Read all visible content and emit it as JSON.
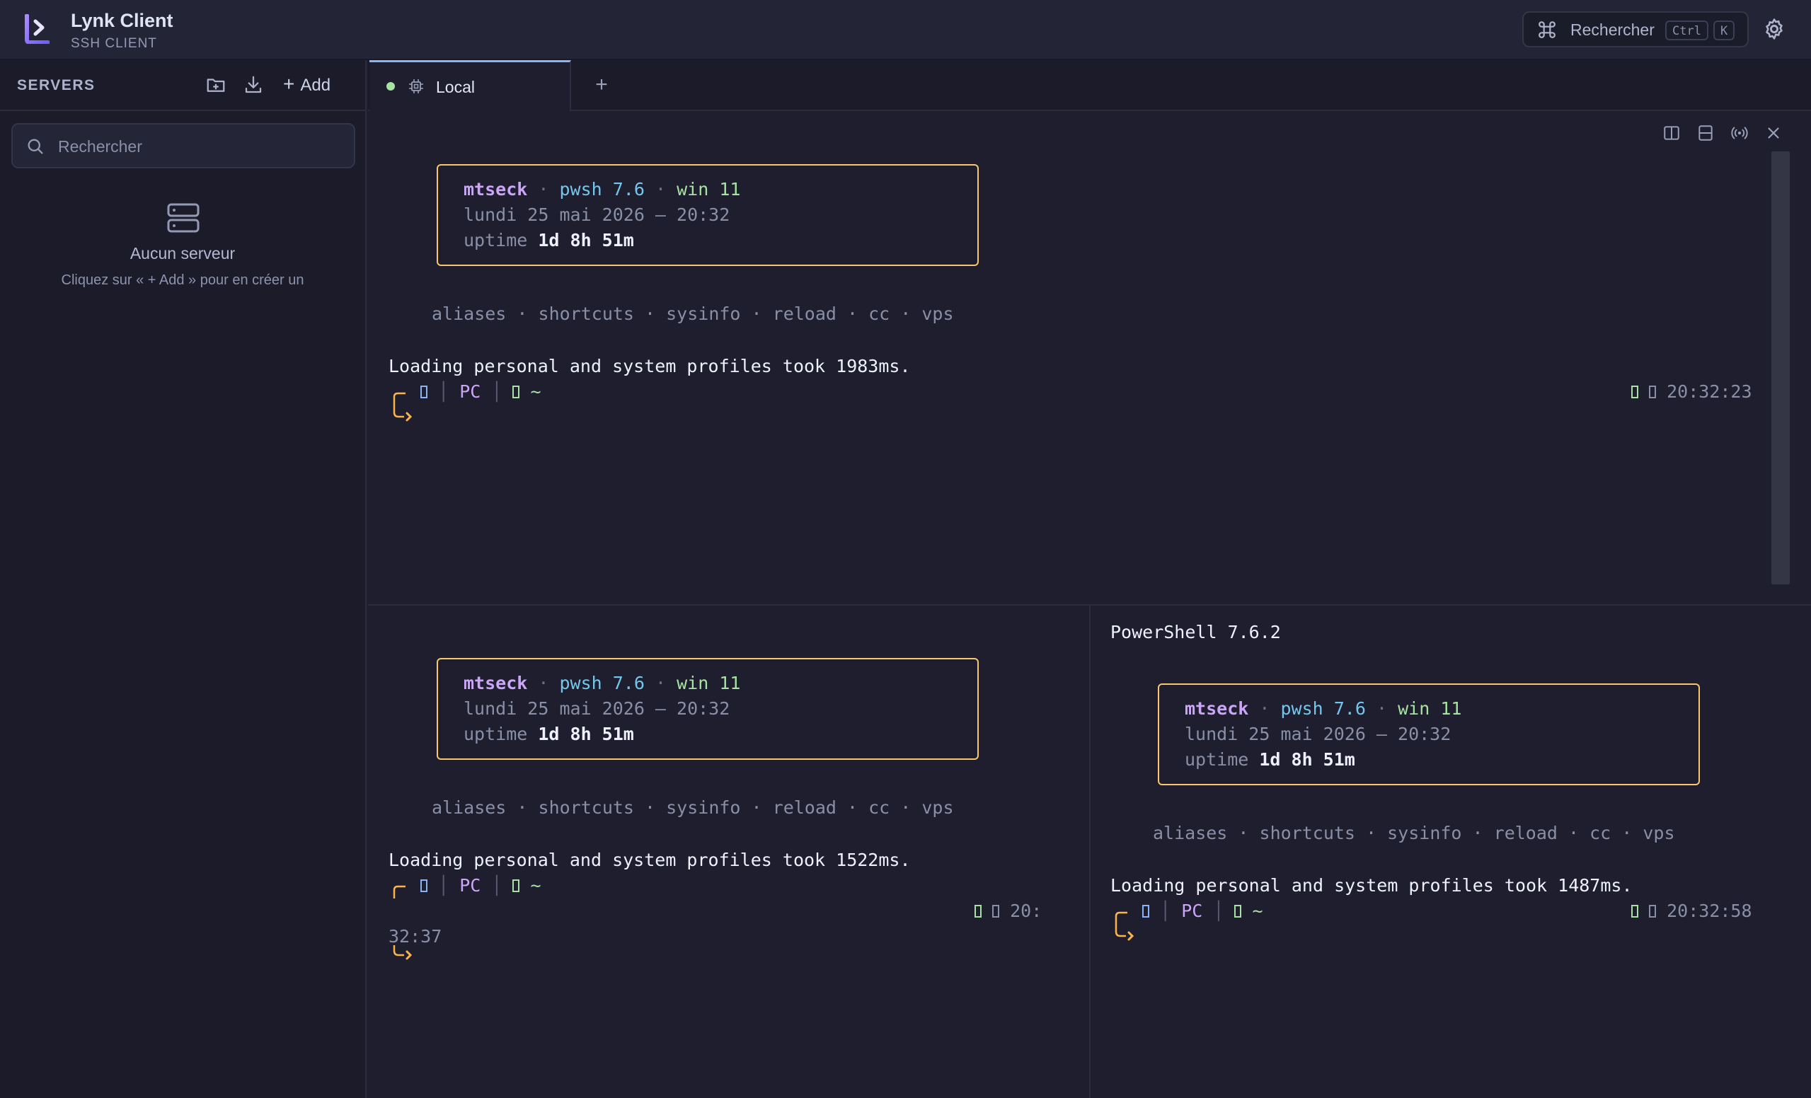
{
  "header": {
    "title": "Lynk Client",
    "subtitle": "SSH CLIENT",
    "search_label": "Rechercher",
    "search_keys": [
      "Ctrl",
      "K"
    ],
    "logo_icon": "lynk-logo-icon",
    "settings_icon": "gear-icon"
  },
  "sidebar": {
    "title": "SERVERS",
    "add_label": "Add",
    "search_placeholder": "Rechercher",
    "empty_title": "Aucun serveur",
    "empty_hint": "Cliquez sur « + Add » pour en créer un"
  },
  "tabs": [
    {
      "label": "Local",
      "status": "connected"
    }
  ],
  "colors": {
    "accent": "#89b4fa",
    "banner_border": "#f9c86a",
    "user": "#cba6f7",
    "shell": "#74c7ec",
    "os": "#a6e3a1",
    "prompt_arrow": "#f9b44e"
  },
  "banner": {
    "user": "mtseck",
    "shell": "pwsh 7.6",
    "os": "win 11",
    "separator": "·",
    "date": "lundi 25 mai 2026 — 20:32",
    "uptime_label": "uptime",
    "uptime_value": "1d 8h 51m",
    "aliases_line": "aliases · shortcuts · sysinfo · reload · cc · vps"
  },
  "prompt": {
    "host": "PC",
    "path": "~"
  },
  "panes": {
    "top": {
      "load_line": "Loading personal and system profiles took 1983ms.",
      "time": "20:32:23"
    },
    "bottom_left": {
      "load_line": "Loading personal and system profiles took 1522ms.",
      "time_part1": "20:",
      "time_part2": "32:37"
    },
    "bottom_right": {
      "header_line": "PowerShell 7.6.2",
      "load_line": "Loading personal and system profiles took 1487ms.",
      "time": "20:32:58"
    }
  }
}
